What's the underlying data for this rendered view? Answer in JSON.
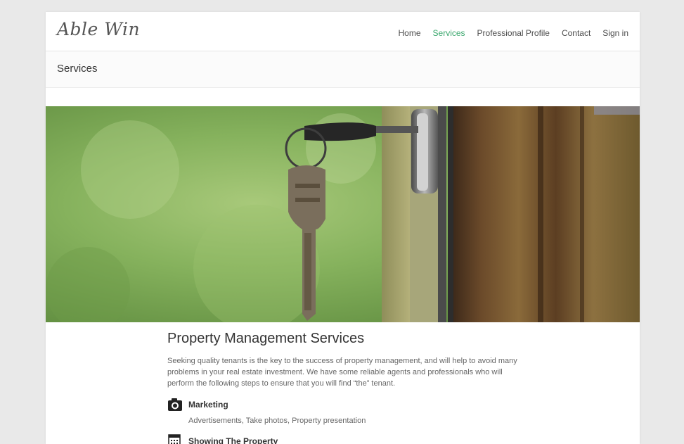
{
  "header": {
    "logo": "Able Win",
    "nav": [
      {
        "label": "Home"
      },
      {
        "label": "Services",
        "active": true
      },
      {
        "label": "Professional Profile"
      },
      {
        "label": "Contact"
      },
      {
        "label": "Sign in"
      }
    ]
  },
  "page_title": "Services",
  "hero": {
    "icon": "house-key-in-door-image"
  },
  "main": {
    "heading": "Property Management Services",
    "intro": "Seeking quality tenants is the key to the success of property management, and will help to avoid many problems in your real estate investment.  We have some reliable agents and professionals who will perform the following steps to ensure that you will find “the” tenant.",
    "services": [
      {
        "icon": "camera-icon",
        "title": "Marketing",
        "description": "Advertisements, Take photos, Property presentation"
      },
      {
        "icon": "calendar-icon",
        "title": "Showing The Property",
        "description": ""
      }
    ]
  },
  "colors": {
    "accent": "#3aa76d",
    "background": "#e9e9e9"
  }
}
